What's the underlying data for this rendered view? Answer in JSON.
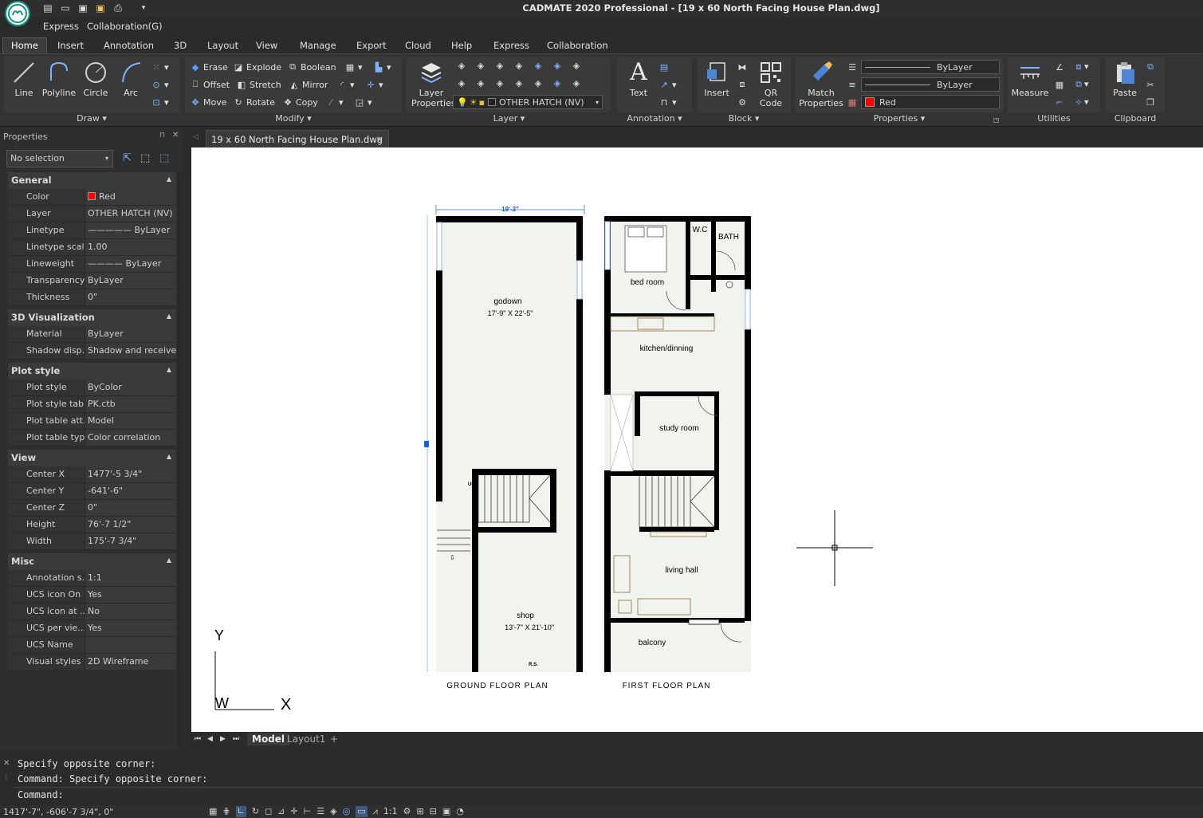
{
  "app": {
    "title": "CADMATE 2020 Professional - [19 x 60 North Facing House Plan.dwg]"
  },
  "menubar": [
    "Express",
    "Collaboration(G)"
  ],
  "tabs": [
    "Home",
    "Insert",
    "Annotation",
    "3D",
    "Layout",
    "View",
    "Manage",
    "Export",
    "Cloud",
    "Help",
    "Express",
    "Collaboration"
  ],
  "ribbon": {
    "draw": {
      "title": "Draw",
      "tools": [
        "Line",
        "Polyline",
        "Circle",
        "Arc"
      ]
    },
    "modify": {
      "title": "Modify",
      "tools": [
        "Erase",
        "Explode",
        "Boolean",
        "Offset",
        "Stretch",
        "Mirror",
        "Move",
        "Rotate",
        "Copy"
      ]
    },
    "layer": {
      "title": "Layer",
      "big": "Layer Properties",
      "current": "OTHER HATCH (NV)"
    },
    "annotation": {
      "title": "Annotation",
      "big": "Text"
    },
    "block": {
      "title": "Block",
      "insert": "Insert",
      "qr": "QR Code"
    },
    "properties": {
      "title": "Properties",
      "big": "Match Properties",
      "linetype": "ByLayer",
      "lineweight": "ByLayer",
      "color": "Red"
    },
    "utilities": {
      "title": "Utilities",
      "big": "Measure"
    },
    "clipboard": {
      "title": "Clipboard",
      "big": "Paste"
    }
  },
  "properties_panel": {
    "header": "Properties",
    "selection": "No selection",
    "sections": [
      {
        "name": "General",
        "rows": [
          [
            "Color",
            "Red"
          ],
          [
            "Layer",
            "OTHER HATCH (NV)"
          ],
          [
            "Linetype",
            "————— ByLayer"
          ],
          [
            "Linetype scale",
            "1.00"
          ],
          [
            "Lineweight",
            "———— ByLayer"
          ],
          [
            "Transparency",
            "ByLayer"
          ],
          [
            "Thickness",
            "0\""
          ]
        ]
      },
      {
        "name": "3D Visualization",
        "rows": [
          [
            "Material",
            "ByLayer"
          ],
          [
            "Shadow disp...",
            "Shadow and receive ..."
          ]
        ]
      },
      {
        "name": "Plot style",
        "rows": [
          [
            "Plot style",
            "ByColor"
          ],
          [
            "Plot style table",
            "PK.ctb"
          ],
          [
            "Plot table att...",
            "Model"
          ],
          [
            "Plot table type",
            "Color correlation"
          ]
        ]
      },
      {
        "name": "View",
        "rows": [
          [
            "Center X",
            "1477'-5 3/4\""
          ],
          [
            "Center Y",
            "-641'-6\""
          ],
          [
            "Center Z",
            "0\""
          ],
          [
            "Height",
            "76'-7 1/2\""
          ],
          [
            "Width",
            "175'-7 3/4\""
          ]
        ]
      },
      {
        "name": "Misc",
        "rows": [
          [
            "Annotation s...",
            "1:1"
          ],
          [
            "UCS icon On",
            "Yes"
          ],
          [
            "UCS icon at ...",
            "No"
          ],
          [
            "UCS per vie...",
            "Yes"
          ],
          [
            "UCS Name",
            ""
          ],
          [
            "Visual styles",
            "2D Wireframe"
          ]
        ]
      }
    ]
  },
  "document_tab": "19 x 60 North Facing House Plan.dwg",
  "drawing": {
    "dimension_top": "19'-3\"",
    "ground_floor_label": "GROUND FLOOR PLAN",
    "first_floor_label": "FIRST FLOOR PLAN",
    "rooms": {
      "godown": "godown",
      "godown_size": "17'-9\" X 22'-5\"",
      "shop": "shop",
      "shop_size": "13'-7\" X 21'-10\"",
      "bedroom": "bed room",
      "wc": "W.C",
      "bath": "BATH",
      "kitchen": "kitchen/dinning",
      "study": "study room",
      "living": "living hall",
      "balcony": "balcony",
      "up": "UP",
      "rs": "R.S."
    },
    "ucs_y": "Y",
    "ucs_w": "W",
    "ucs_x": "X"
  },
  "layout_tabs": [
    "Model",
    "Layout1",
    "+"
  ],
  "command_lines": [
    "Specify opposite corner:",
    "Command: Specify opposite corner:",
    "Command:"
  ],
  "status_coords": "1417'-7\", -606'-7 3/4\", 0\"",
  "status_scale": "1:1"
}
